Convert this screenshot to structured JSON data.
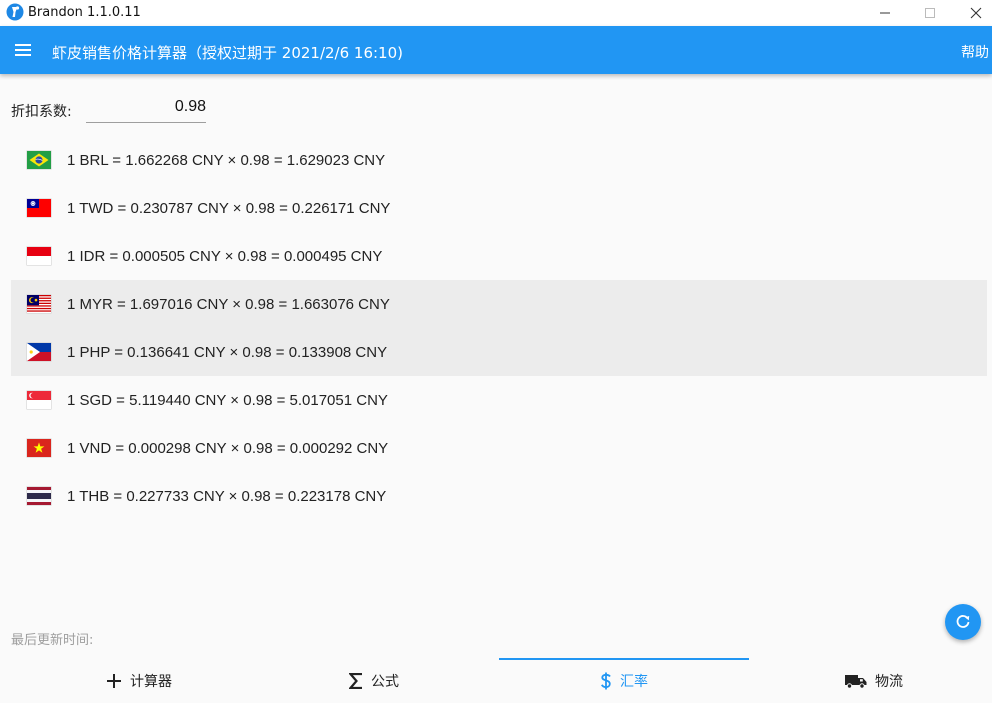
{
  "window": {
    "title": "Brandon 1.1.0.11"
  },
  "appbar": {
    "title": "虾皮销售价格计算器（授权过期于 2021/2/6 16:10)",
    "help_label": "帮助",
    "menu_icon": "hamburger-menu-icon"
  },
  "discount": {
    "label": "折扣系数:",
    "value": "0.98"
  },
  "rates": [
    {
      "currency": "BRL",
      "flag": "brazil-flag-icon",
      "text": "1 BRL = 1.662268 CNY × 0.98 = 1.629023 CNY",
      "highlighted": false
    },
    {
      "currency": "TWD",
      "flag": "taiwan-flag-icon",
      "text": "1 TWD = 0.230787 CNY × 0.98 = 0.226171 CNY",
      "highlighted": false
    },
    {
      "currency": "IDR",
      "flag": "indonesia-flag-icon",
      "text": "1 IDR = 0.000505 CNY × 0.98 = 0.000495 CNY",
      "highlighted": false
    },
    {
      "currency": "MYR",
      "flag": "malaysia-flag-icon",
      "text": "1 MYR = 1.697016 CNY × 0.98 = 1.663076 CNY",
      "highlighted": true
    },
    {
      "currency": "PHP",
      "flag": "philippines-flag-icon",
      "text": "1 PHP = 0.136641 CNY × 0.98 = 0.133908 CNY",
      "highlighted": true
    },
    {
      "currency": "SGD",
      "flag": "singapore-flag-icon",
      "text": "1 SGD = 5.119440 CNY × 0.98 = 5.017051 CNY",
      "highlighted": false
    },
    {
      "currency": "VND",
      "flag": "vietnam-flag-icon",
      "text": "1 VND = 0.000298 CNY × 0.98 = 0.000292 CNY",
      "highlighted": false
    },
    {
      "currency": "THB",
      "flag": "thailand-flag-icon",
      "text": "1 THB = 0.227733 CNY × 0.98 = 0.223178 CNY",
      "highlighted": false
    }
  ],
  "last_update": {
    "label": "最后更新时间:"
  },
  "tabs": [
    {
      "label": "计算器",
      "icon": "plus-icon",
      "active": false
    },
    {
      "label": "公式",
      "icon": "sigma-icon",
      "active": false
    },
    {
      "label": "汇率",
      "icon": "dollar-icon",
      "active": true
    },
    {
      "label": "物流",
      "icon": "truck-icon",
      "active": false
    }
  ],
  "colors": {
    "primary": "#2196f3",
    "highlight_row": "#ececec",
    "background": "#fafafa"
  }
}
